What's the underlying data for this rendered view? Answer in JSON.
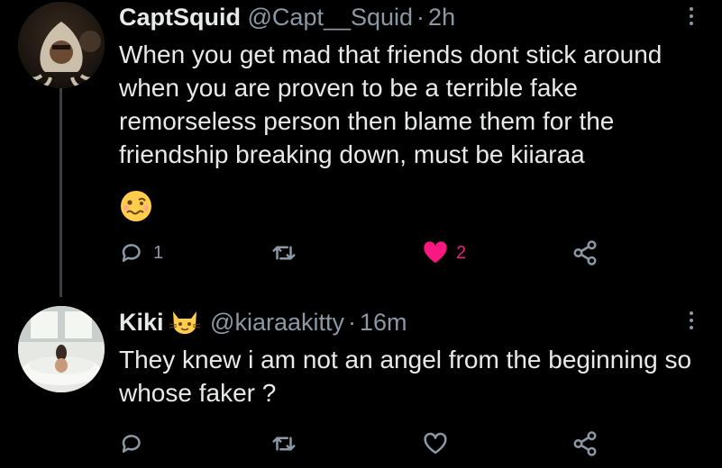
{
  "tweets": [
    {
      "display_name": "CaptSquid",
      "handle": "@Capt__Squid",
      "separator": "·",
      "time": "2h",
      "text": "When you get mad that friends dont stick around when you are proven to be a terrible fake remorseless person then blame them for the friendship breaking down, must be kiiaraa",
      "emoji": "woozy-face-emoji",
      "replies": "1",
      "retweets": "",
      "likes": "2",
      "liked": true
    },
    {
      "display_name": "Kiki",
      "name_emoji": "cat-face-emoji",
      "handle": "@kiaraakitty",
      "separator": "·",
      "time": "16m",
      "text": "They knew i am not an angel from the beginning so whose faker ?",
      "replies": "",
      "retweets": "",
      "likes": "",
      "liked": false
    }
  ],
  "colors": {
    "background": "#000000",
    "text": "#e7e9ea",
    "secondary": "#8b98a5",
    "like_pink": "#f91880",
    "thread_line": "#3b3f45"
  },
  "icons": [
    "reply-icon",
    "retweet-icon",
    "like-icon",
    "share-icon",
    "more-options-icon"
  ]
}
